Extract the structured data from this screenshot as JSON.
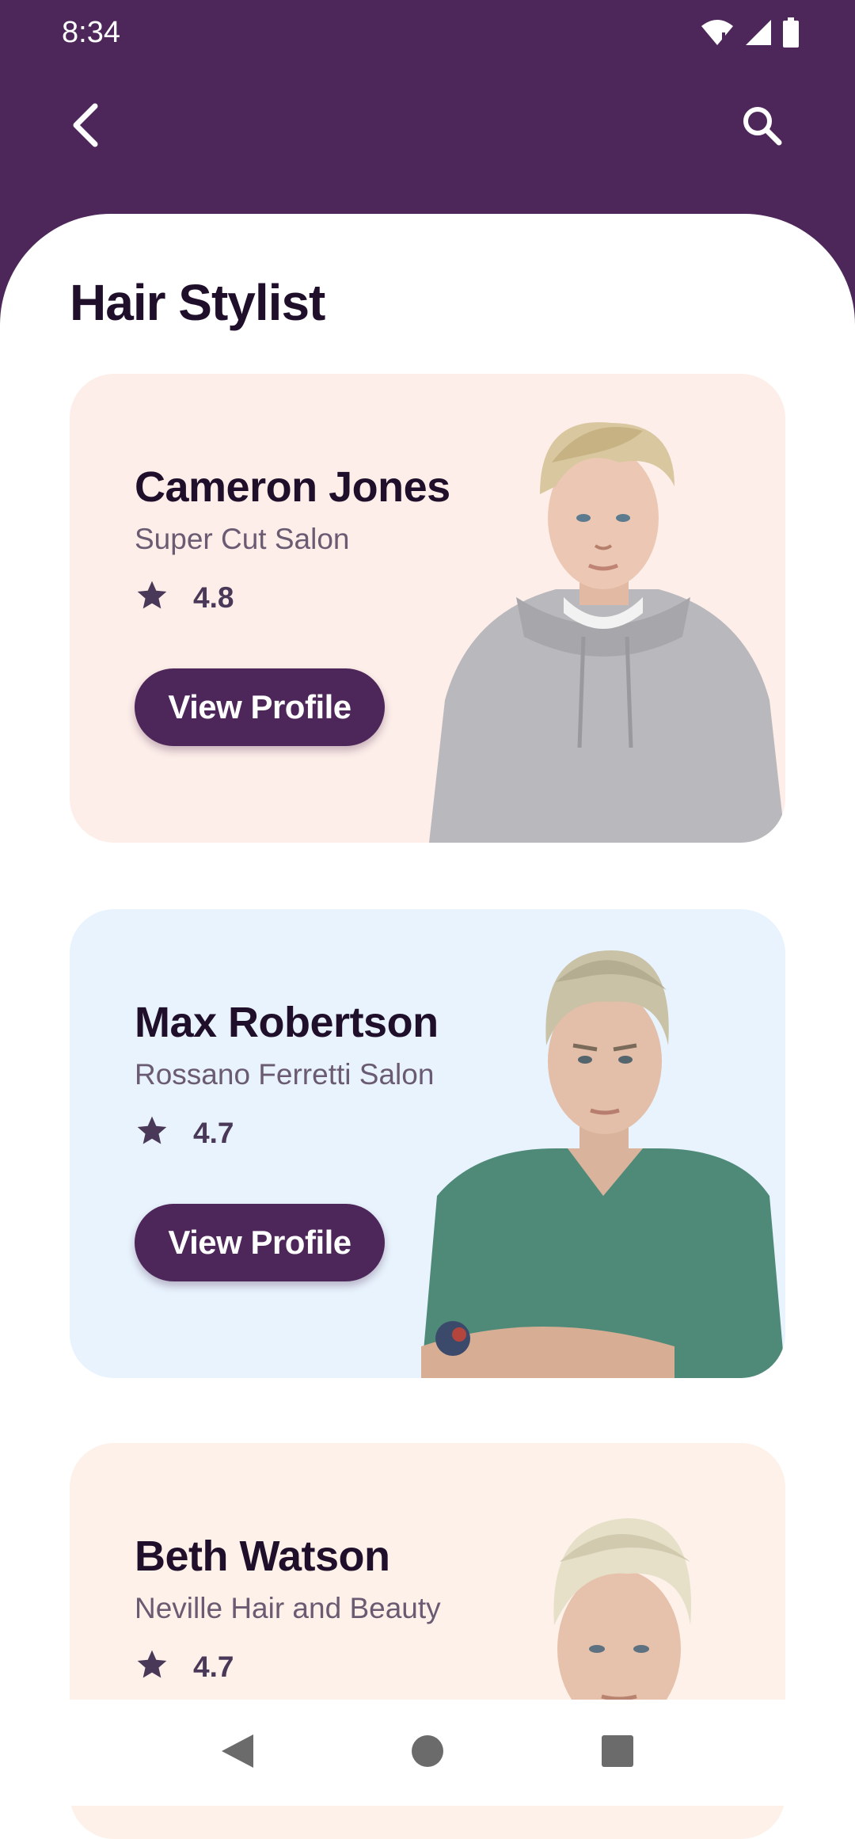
{
  "status_bar": {
    "time": "8:34",
    "icons": [
      "wifi-icon",
      "signal-icon",
      "battery-icon"
    ]
  },
  "toolbar": {
    "back_icon": "chevron-left-icon",
    "search_icon": "search-icon"
  },
  "page": {
    "title": "Hair Stylist"
  },
  "stylists": [
    {
      "name": "Cameron Jones",
      "salon": "Super Cut Salon",
      "rating": "4.8",
      "button_label": "View Profile",
      "card_color": "#fdeee9"
    },
    {
      "name": "Max Robertson",
      "salon": "Rossano Ferretti Salon",
      "rating": "4.7",
      "button_label": "View Profile",
      "card_color": "#e8f3fd"
    },
    {
      "name": "Beth Watson",
      "salon": "Neville Hair and Beauty",
      "rating": "4.7",
      "card_color": "#fdf1e9"
    }
  ],
  "nav_bar": {
    "icons": [
      "nav-back-icon",
      "nav-home-icon",
      "nav-recents-icon"
    ]
  },
  "colors": {
    "primary": "#4e275a",
    "title_text": "#1f0f2b",
    "secondary_text": "#6a5b73"
  }
}
